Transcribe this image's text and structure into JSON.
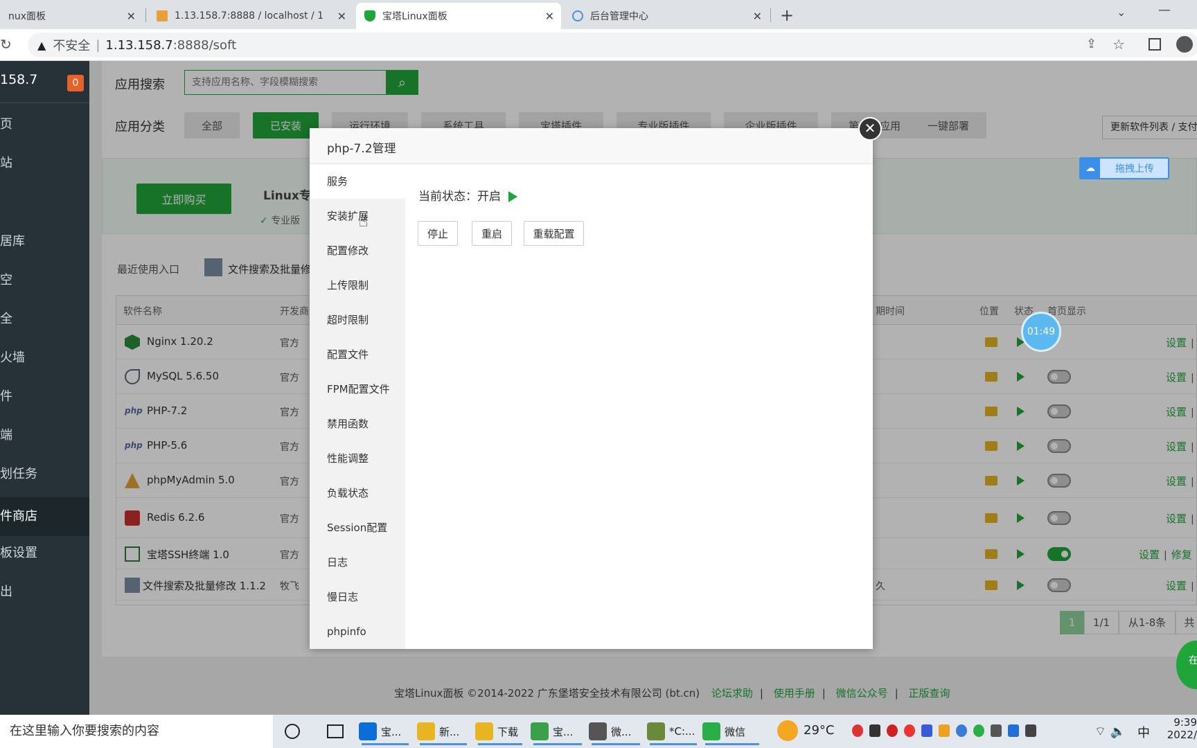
{
  "browser": {
    "tabs": [
      {
        "title": "nux面板"
      },
      {
        "title": "1.13.158.7:8888 / localhost / 1"
      },
      {
        "title": "宝塔Linux面板"
      },
      {
        "title": "后台管理中心"
      }
    ],
    "security_label": "不安全",
    "url_host": "1.13.158.7",
    "url_rest": ":8888/soft"
  },
  "sidebar": {
    "ip": "158.7",
    "badge": "0",
    "items": [
      "页",
      "站",
      "",
      "居库",
      "空",
      "全",
      "火墙",
      "件",
      "端",
      "划任务",
      "件商店",
      "板设置",
      "出"
    ]
  },
  "top": {
    "search_label": "应用搜索",
    "search_placeholder": "支持应用名称、字段模糊搜索",
    "category_label": "应用分类",
    "categories": [
      "全部",
      "已安装",
      "运行环境",
      "系统工具",
      "宝塔插件",
      "专业版插件",
      "企业版插件",
      "第三方应用",
      "一键部署"
    ],
    "update_btn": "更新软件列表 / 支付检",
    "upload_btn": "拖拽上传"
  },
  "promo": {
    "buy_btn": "立即购买",
    "title": "Linux专",
    "check": "专业版"
  },
  "recent": {
    "label": "最近使用入口",
    "item": "文件搜索及批量修"
  },
  "table": {
    "headers": {
      "name": "软件名称",
      "dev": "开发商",
      "expire": "期时间",
      "loc": "位置",
      "status": "状态",
      "home": "首页显示"
    },
    "rows": [
      {
        "name": "Nginx 1.20.2",
        "dev": "官方",
        "icon": "nginx-icon",
        "home_on": false
      },
      {
        "name": "MySQL 5.6.50",
        "dev": "官方",
        "icon": "mysql-icon",
        "home_on": false
      },
      {
        "name": "PHP-7.2",
        "dev": "官方",
        "icon": "php-icon",
        "home_on": false
      },
      {
        "name": "PHP-5.6",
        "dev": "官方",
        "icon": "php-icon",
        "home_on": false
      },
      {
        "name": "phpMyAdmin 5.0",
        "dev": "官方",
        "icon": "phpmyadmin-icon",
        "home_on": false
      },
      {
        "name": "Redis 6.2.6",
        "dev": "官方",
        "icon": "redis-icon",
        "home_on": false
      },
      {
        "name": "宝塔SSH终端 1.0",
        "dev": "官方",
        "icon": "terminal-icon",
        "home_on": true
      },
      {
        "name": "文件搜索及批量修改 1.1.2",
        "dev": "牧飞",
        "icon": "search-tool-icon",
        "home_on": false
      }
    ],
    "row_expire_last": "久",
    "action_set": "设置",
    "action_repair": "修复",
    "sep": "|"
  },
  "pagination": {
    "current": "1",
    "pages": "1/1",
    "range": "从1-8条",
    "total": "共"
  },
  "timer": "01:49",
  "footer": {
    "copyright": "宝塔Linux面板 ©2014-2022 广东堡塔安全技术有限公司 (bt.cn)",
    "links": [
      "论坛求助",
      "使用手册",
      "微信公众号",
      "正版查询"
    ]
  },
  "modal": {
    "title": "php-7.2管理",
    "nav": [
      "服务",
      "安装扩展",
      "配置修改",
      "上传限制",
      "超时限制",
      "配置文件",
      "FPM配置文件",
      "禁用函数",
      "性能调整",
      "负载状态",
      "Session配置",
      "日志",
      "慢日志",
      "phpinfo"
    ],
    "status_label": "当前状态：",
    "status_value": "开启",
    "buttons": [
      "停止",
      "重启",
      "重载配置"
    ]
  },
  "float_chat": "在看",
  "taskbar": {
    "search": "在这里输入你要搜索的内容",
    "apps": [
      "宝...",
      "新...",
      "下载",
      "宝...",
      "微...",
      "*C:...",
      "微信"
    ],
    "weather": "29°C",
    "ime": "中",
    "time": "9:39",
    "date": "2022/"
  },
  "colors": {
    "accent": "#20a53a",
    "sidebar": "#263238"
  }
}
